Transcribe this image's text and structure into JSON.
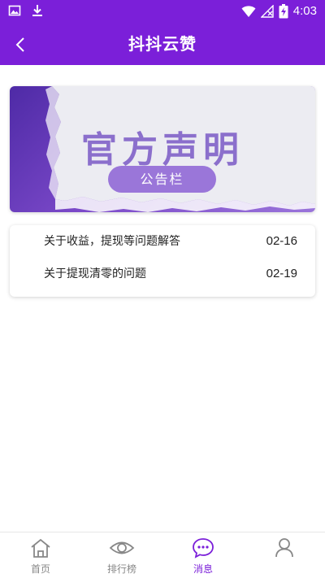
{
  "status_bar": {
    "time": "4:03"
  },
  "header": {
    "title": "抖抖云赞"
  },
  "banner": {
    "title": "官方声明",
    "pill_label": "公告栏"
  },
  "notices": [
    {
      "title": "关于收益，提现等问题解答",
      "date": "02-16"
    },
    {
      "title": "关于提现清零的问题",
      "date": "02-19"
    }
  ],
  "tabs": [
    {
      "label": "首页",
      "icon": "home-icon"
    },
    {
      "label": "排行榜",
      "icon": "eye-icon"
    },
    {
      "label": "消息",
      "icon": "chat-icon",
      "active": true
    },
    {
      "label": "",
      "icon": "user-icon"
    }
  ],
  "colors": {
    "brand": "#7b1fd9",
    "banner_text": "#8b6fcc",
    "inactive_tab": "#888888"
  }
}
